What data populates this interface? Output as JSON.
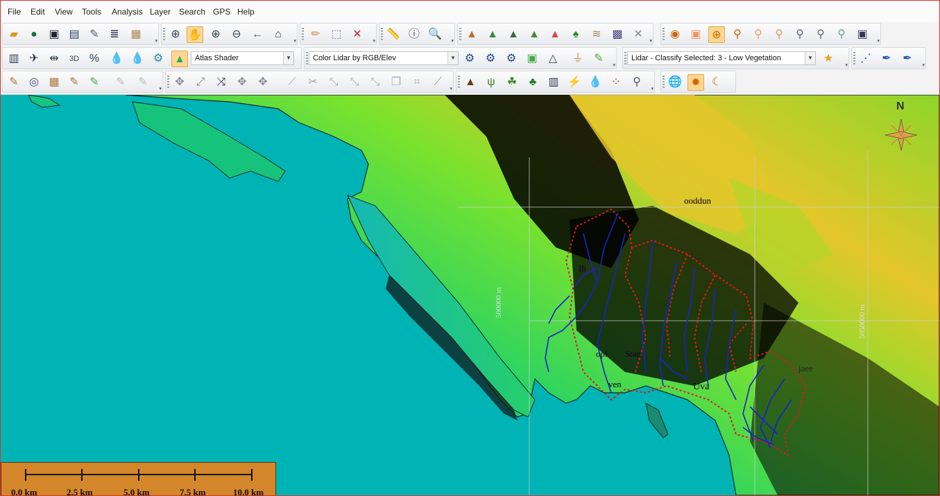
{
  "menu": [
    "File",
    "Edit",
    "View",
    "Tools",
    "Analysis",
    "Layer",
    "Search",
    "GPS",
    "Help"
  ],
  "toolbar": {
    "shader_combo": "Atlas Shader",
    "color_combo": "Color Lidar by RGB/Elev",
    "classify_combo": "Lidar - Classify Selected:  3 - Low Vegetation"
  },
  "map": {
    "labels": {
      "upper": "ooddun",
      "left_mid": "Ih",
      "bay_left": "opl",
      "bay_mid": "Stan",
      "lower_left": "ven",
      "uva": "Uva",
      "right": "jaee",
      "grid_left": "500000 m",
      "grid_right": "5050000 m"
    },
    "north_label": "N",
    "colors": {
      "water": "#00b3b5",
      "low_elevation": "#19c96a",
      "mid_elevation": "#7ee02b",
      "high_elevation": "#e1c42a",
      "streams": "#1a22c8",
      "watershed_boundary": "#e01818"
    }
  },
  "scalebar": {
    "labels": [
      "0.0 km",
      "2.5 km",
      "5.0 km",
      "7.5 km",
      "10.0 km"
    ]
  }
}
